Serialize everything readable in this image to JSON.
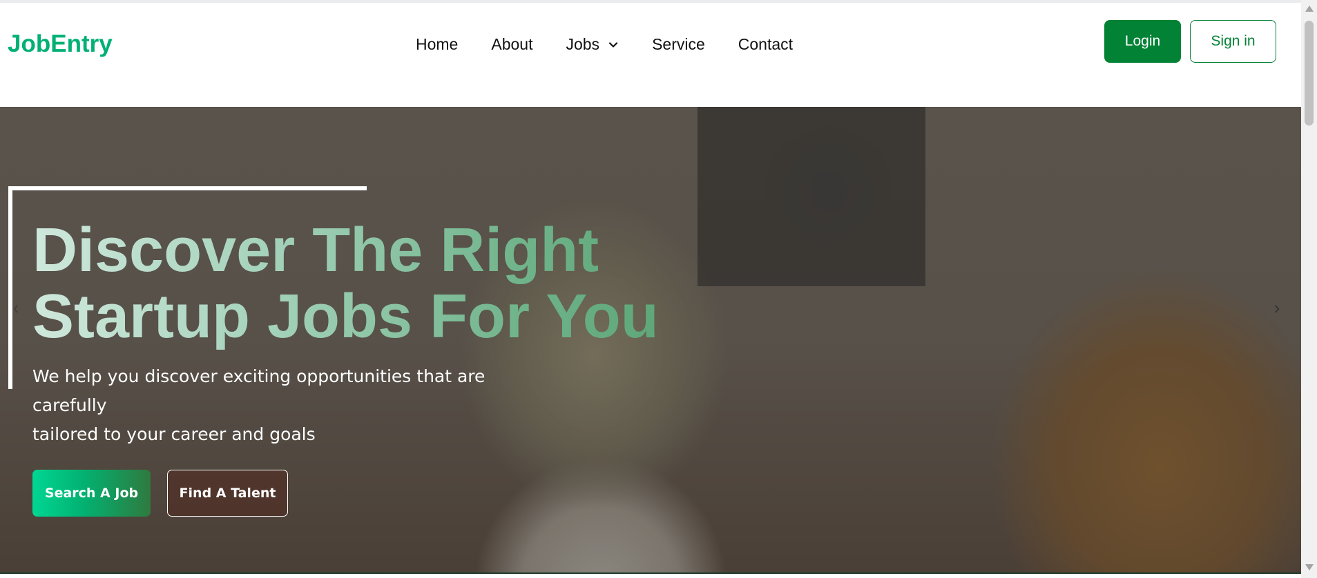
{
  "brand": {
    "name": "JobEntry"
  },
  "nav": {
    "items": [
      {
        "label": "Home"
      },
      {
        "label": "About"
      },
      {
        "label": "Jobs",
        "has_dropdown": true
      },
      {
        "label": "Service"
      },
      {
        "label": "Contact"
      }
    ]
  },
  "auth": {
    "login_label": "Login",
    "signin_label": "Sign in"
  },
  "hero": {
    "title_line1": "Discover The Right",
    "title_line2": "Startup Jobs For You",
    "subtitle_line1": "We help you discover exciting opportunities that are carefully",
    "subtitle_line2": "tailored to your career and goals",
    "primary_cta": "Search A Job",
    "secondary_cta": "Find A Talent",
    "prev_icon": "‹",
    "next_icon": "›"
  },
  "colors": {
    "brand": "#00b074",
    "primary_button": "#028235",
    "accent_gradient_start": "#00d693",
    "accent_gradient_end": "#2f7a3f"
  },
  "icons": {
    "jobs_dropdown": "chevron-down-icon",
    "carousel_prev": "chevron-left-icon",
    "carousel_next": "chevron-right-icon"
  }
}
